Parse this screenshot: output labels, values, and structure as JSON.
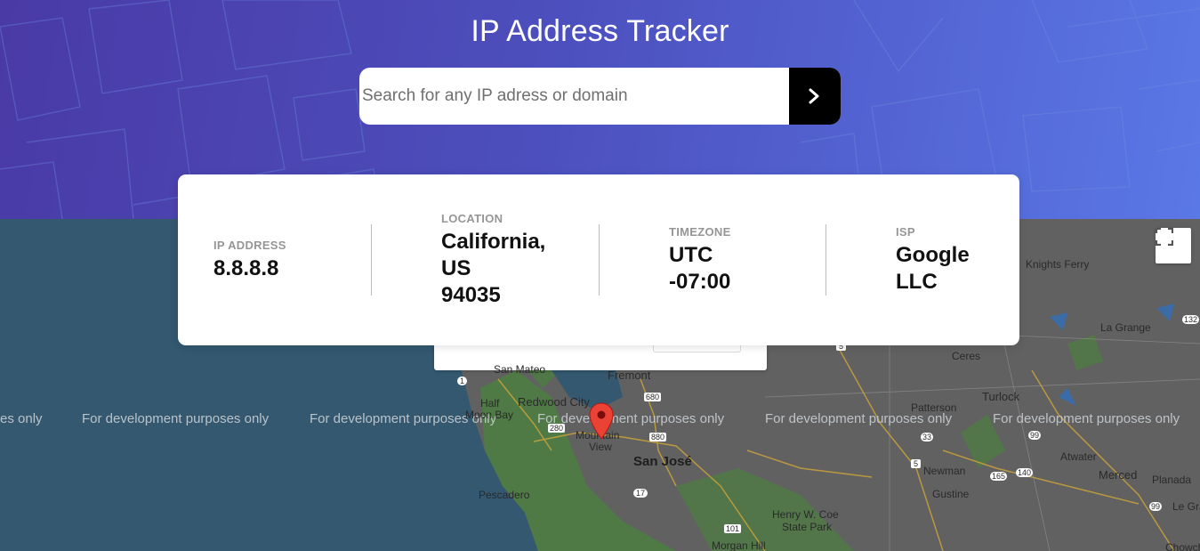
{
  "header": {
    "title": "IP Address Tracker",
    "background_colors": [
      "#4a3aa6",
      "#4c4fbd",
      "#5a78e6"
    ]
  },
  "search": {
    "placeholder": "Search for any IP adress or domain",
    "value": "",
    "button_icon": "chevron-right-icon",
    "button_color": "#000000"
  },
  "info": {
    "ip_address": {
      "label": "IP ADDRESS",
      "value": "8.8.8.8"
    },
    "location": {
      "label": "LOCATION",
      "value_line1": "California,",
      "value_line2": "US",
      "value_line3": "94035"
    },
    "timezone": {
      "label": "TIMEZONE",
      "value_line1": "UTC",
      "value_line2": "-07:00"
    },
    "isp": {
      "label": "ISP",
      "value_line1": "Google",
      "value_line2": "LLC"
    }
  },
  "map": {
    "watermark": "For development purposes only",
    "watermark_partial": "es only",
    "fullscreen_icon": "fullscreen-icon",
    "marker_icon": "map-pin-icon",
    "marker_color": "#d93025",
    "labels": {
      "fremont": "Fremont",
      "redwood_city": "Redwood City",
      "san_mateo": "San Mateo",
      "half_moon_bay_1": "Half",
      "half_moon_bay_2": "Moon Bay",
      "mountain_view_1": "Mountain",
      "mountain_view_2": "View",
      "san_jose": "San José",
      "pescadero": "Pescadero",
      "henry_coe_1": "Henry W. Coe",
      "henry_coe_2": "State Park",
      "morgan_hill": "Morgan Hill",
      "knights_ferry": "Knights Ferry",
      "la_grange": "La Grange",
      "ceres": "Ceres",
      "turlock": "Turlock",
      "patterson": "Patterson",
      "newman": "Newman",
      "gustine": "Gustine",
      "atwater": "Atwater",
      "merced": "Merced",
      "planada": "Planada",
      "le_grand": "Le Gra",
      "chowchilla": "Chowch",
      "route_680": "680",
      "route_880": "880",
      "route_280": "280",
      "route_101": "101",
      "route_1": "1",
      "route_5a": "5",
      "route_5b": "5",
      "route_33": "33",
      "route_99a": "99",
      "route_99b": "99",
      "route_140": "140",
      "route_165": "165",
      "route_132": "132",
      "route_17": "17"
    }
  }
}
